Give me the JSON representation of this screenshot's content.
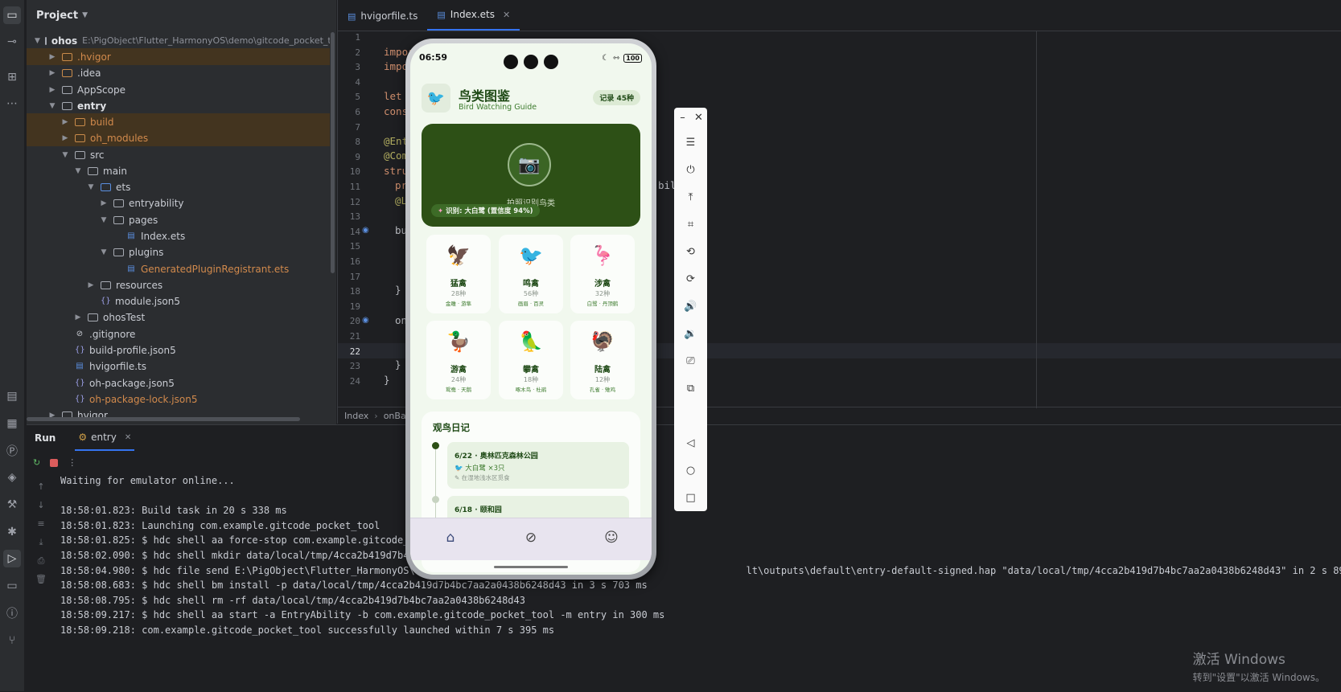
{
  "project_panel": {
    "title": "Project",
    "root_name": "ohos",
    "root_path": "E:\\PigObject\\Flutter_HarmonyOS\\demo\\gitcode_pocket_tool\\oh",
    "items": [
      {
        "label": ".hvigor"
      },
      {
        "label": ".idea"
      },
      {
        "label": "AppScope"
      },
      {
        "label": "entry"
      },
      {
        "label": "build"
      },
      {
        "label": "oh_modules"
      },
      {
        "label": "src"
      },
      {
        "label": "main"
      },
      {
        "label": "ets"
      },
      {
        "label": "entryability"
      },
      {
        "label": "pages"
      },
      {
        "label": "Index.ets"
      },
      {
        "label": "plugins"
      },
      {
        "label": "GeneratedPluginRegistrant.ets"
      },
      {
        "label": "resources"
      },
      {
        "label": "module.json5"
      },
      {
        "label": "ohosTest"
      },
      {
        "label": ".gitignore"
      },
      {
        "label": "build-profile.json5"
      },
      {
        "label": "hvigorfile.ts"
      },
      {
        "label": "oh-package.json5"
      },
      {
        "label": "oh-package-lock.json5"
      },
      {
        "label": "hvigor"
      }
    ]
  },
  "editor": {
    "tabs": [
      {
        "label": "hvigorfile.ts"
      },
      {
        "label": "Index.ets"
      }
    ],
    "line_numbers": [
      "1",
      "2",
      "3",
      "4",
      "5",
      "6",
      "7",
      "8",
      "9",
      "10",
      "11",
      "12",
      "13",
      "14",
      "15",
      "16",
      "17",
      "18",
      "19",
      "20",
      "21",
      "22",
      "23",
      "24"
    ],
    "code": {
      "l2": "impor",
      "l3": "impo",
      "l5": "let",
      "l6": "cons",
      "l8": "@Ent",
      "l9": "@Com",
      "l10": "stru",
      "l11": "pr",
      "l11_right": "bili ext",
      "l12": "@L",
      "l14": "bu",
      "l18": "}",
      "l20": "on",
      "l23": "}",
      "l24": "}"
    },
    "breadcrumb": [
      "Index",
      "onBac"
    ]
  },
  "run_panel": {
    "title": "Run",
    "tab_label": "entry",
    "log_lines": [
      "Waiting for emulator online...",
      "",
      "18:58:01.823: Build task in 20 s 338 ms",
      "18:58:01.823: Launching com.example.gitcode_pocket_tool",
      "18:58:01.825: $ hdc shell aa force-stop com.example.gitcode_pock",
      "18:58:02.090: $ hdc shell mkdir data/local/tmp/4cca2b419d7b4bc7a",
      "18:58:04.980: $ hdc file send E:\\PigObject\\Flutter_HarmonyOS\\demo                                                     lt\\outputs\\default\\entry-default-signed.hap \"data/local/tmp/4cca2b419d7b4bc7aa2a0438b6248d43\" in 2 s 890 ms",
      "18:58:08.683: $ hdc shell bm install -p data/local/tmp/4cca2b419d7b4bc7aa2a0438b6248d43 in 3 s 703 ms",
      "18:58:08.795: $ hdc shell rm -rf data/local/tmp/4cca2b419d7b4bc7aa2a0438b6248d43",
      "18:58:09.217: $ hdc shell aa start -a EntryAbility -b com.example.gitcode_pocket_tool -m entry in 300 ms",
      "18:58:09.218: com.example.gitcode_pocket_tool successfully launched within 7 s 395 ms"
    ]
  },
  "watermark": {
    "title": "激活 Windows",
    "subtitle": "转到\"设置\"以激活 Windows。"
  },
  "phone": {
    "time": "06:59",
    "battery": "100",
    "app_title": "鸟类图鉴",
    "app_subtitle": "Bird Watching Guide",
    "record_badge": "记录 45种",
    "hero_text": "拍照识别鸟类",
    "hero_chip": "识别: 大白鹭 (置信度 94%)",
    "categories": [
      {
        "emoji": "🦅",
        "name": "猛禽",
        "count": "28种",
        "examples": "金雕 · 游隼"
      },
      {
        "emoji": "🐦",
        "name": "鸣禽",
        "count": "56种",
        "examples": "画眉 · 百灵"
      },
      {
        "emoji": "🦩",
        "name": "涉禽",
        "count": "32种",
        "examples": "白鹭 · 丹顶鹤"
      },
      {
        "emoji": "🦆",
        "name": "游禽",
        "count": "24种",
        "examples": "鸳鸯 · 天鹅"
      },
      {
        "emoji": "🦜",
        "name": "攀禽",
        "count": "18种",
        "examples": "啄木鸟 · 杜鹃"
      },
      {
        "emoji": "🦃",
        "name": "陆禽",
        "count": "12种",
        "examples": "孔雀 · 雉鸡"
      }
    ],
    "diary_title": "观鸟日记",
    "diary": [
      {
        "title": "6/22 · 奥林匹克森林公园",
        "bird": "大白鹭 ×3只",
        "note": "在湿地浅水区觅食"
      },
      {
        "title": "6/18 · 颐和园",
        "bird": "",
        "note": ""
      }
    ],
    "colors": {
      "primary": "#2d5016",
      "background": "#f1f8ee"
    }
  }
}
